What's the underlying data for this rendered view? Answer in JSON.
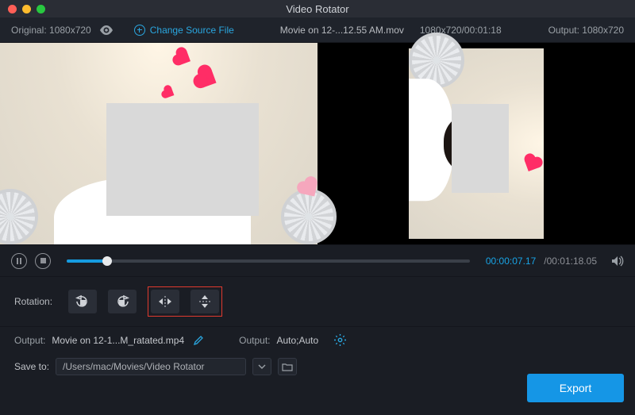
{
  "titlebar": {
    "title": "Video Rotator"
  },
  "infobar": {
    "original_label": "Original: 1080x720",
    "change_source": "Change Source File",
    "filename": "Movie on 12-...12.55 AM.mov",
    "src_info": "1080x720/00:01:18",
    "output_label": "Output: 1080x720"
  },
  "playbar": {
    "time_current": "00:00:07.17",
    "time_total": "/00:01:18.05"
  },
  "rotation": {
    "label": "Rotation:"
  },
  "output": {
    "label1": "Output:",
    "filename": "Movie on 12-1...M_ratated.mp4",
    "label2": "Output:",
    "mode": "Auto;Auto"
  },
  "save": {
    "label": "Save to:",
    "path": "/Users/mac/Movies/Video Rotator"
  },
  "export": {
    "label": "Export"
  }
}
